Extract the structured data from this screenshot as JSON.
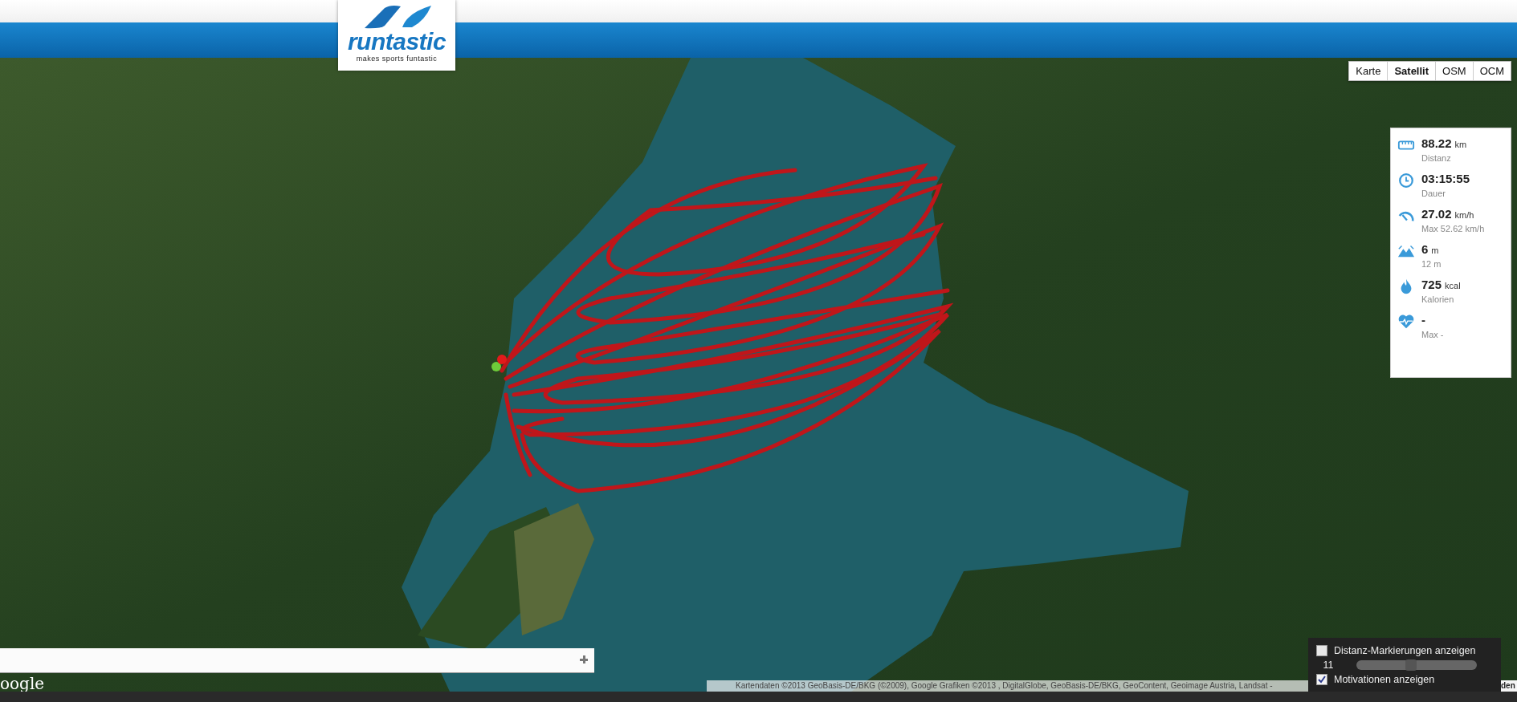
{
  "header": {
    "logo_wordmark": "runtastic",
    "logo_tagline": "makes sports funtastic"
  },
  "map": {
    "map_types": [
      {
        "label": "Karte",
        "selected": false
      },
      {
        "label": "Satellit",
        "selected": true
      },
      {
        "label": "OSM",
        "selected": false
      },
      {
        "label": "OCM",
        "selected": false
      }
    ],
    "stats": [
      {
        "kind": "distance",
        "value": "88.22",
        "unit": "km",
        "caption": "Distanz"
      },
      {
        "kind": "duration",
        "value": "03:15:55",
        "caption": "Dauer"
      },
      {
        "kind": "speed",
        "value": "27.02",
        "unit": "km/h",
        "caption": "Max 52.62 km/h"
      },
      {
        "kind": "elevation",
        "value": "6",
        "unit": "m",
        "caption": "12 m"
      },
      {
        "kind": "calories",
        "value": "725",
        "unit": "kcal",
        "caption": "Kalorien"
      },
      {
        "kind": "heart_rate",
        "value": "-",
        "caption": "Max -"
      }
    ],
    "google_logo": "oogle",
    "attribution": "Kartendaten ©2013 GeoBasis-DE/BKG (©2009), Google Grafiken ©2013 , DigitalGlobe, GeoBasis-DE/BKG, GeoContent, Geoimage Austria, Landsat -",
    "attribution_end": "den",
    "options": {
      "distance_markers": {
        "label": "Distanz-Markierungen anzeigen",
        "checked": false
      },
      "marker_slider": {
        "value": "11",
        "level": 0.45
      },
      "motivations": {
        "label": "Motivationen anzeigen",
        "checked": true
      }
    }
  }
}
